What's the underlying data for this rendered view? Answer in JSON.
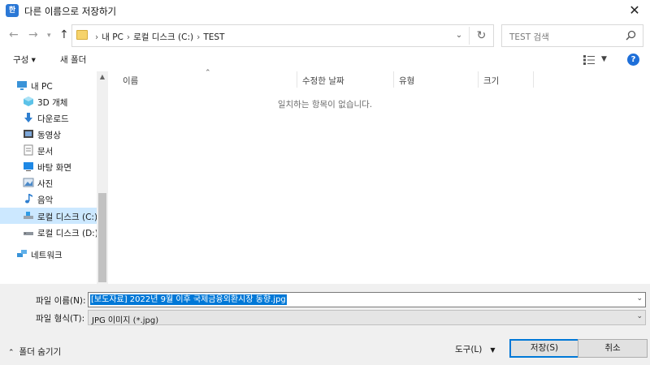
{
  "window": {
    "title": "다른 이름으로 저장하기",
    "icon_letter": "한"
  },
  "nav": {
    "back": "←",
    "forward": "→",
    "recent": "▾",
    "up": "↑",
    "breadcrumbs": [
      "내 PC",
      "로컬 디스크 (C:)",
      "TEST"
    ],
    "search_placeholder": "TEST 검색"
  },
  "toolbar": {
    "organize": "구성 ▾",
    "new_folder": "새 폴더",
    "help": "?"
  },
  "sidebar": {
    "items": [
      {
        "label": "내 PC",
        "icon": "pc-icon"
      },
      {
        "label": "3D 개체",
        "icon": "cube-icon"
      },
      {
        "label": "다운로드",
        "icon": "download-icon"
      },
      {
        "label": "동영상",
        "icon": "video-icon"
      },
      {
        "label": "문서",
        "icon": "document-icon"
      },
      {
        "label": "바탕 화면",
        "icon": "desktop-icon"
      },
      {
        "label": "사진",
        "icon": "picture-icon"
      },
      {
        "label": "음악",
        "icon": "music-icon"
      },
      {
        "label": "로컬 디스크 (C:)",
        "icon": "drive-icon",
        "selected": true
      },
      {
        "label": "로컬 디스크 (D:)",
        "icon": "drive-icon"
      },
      {
        "label": "네트워크",
        "icon": "network-icon"
      }
    ]
  },
  "filelist": {
    "columns": [
      "이름",
      "수정한 날짜",
      "유형",
      "크기"
    ],
    "empty_message": "일치하는 항목이 없습니다."
  },
  "form": {
    "filename_label": "파일 이름(N):",
    "filename_value": "[보도자료] 2022년 9월 이후 국제금융외환시장 동향.jpg",
    "filetype_label": "파일 형식(T):",
    "filetype_value": "JPG 이미지 (*.jpg)"
  },
  "footer": {
    "hide_folders": "폴더 숨기기",
    "tools": "도구(L)",
    "save": "저장(S)",
    "cancel": "취소"
  },
  "colors": {
    "accent": "#0078d7",
    "selected_bg": "#cce8ff",
    "help": "#1e6fd9"
  }
}
